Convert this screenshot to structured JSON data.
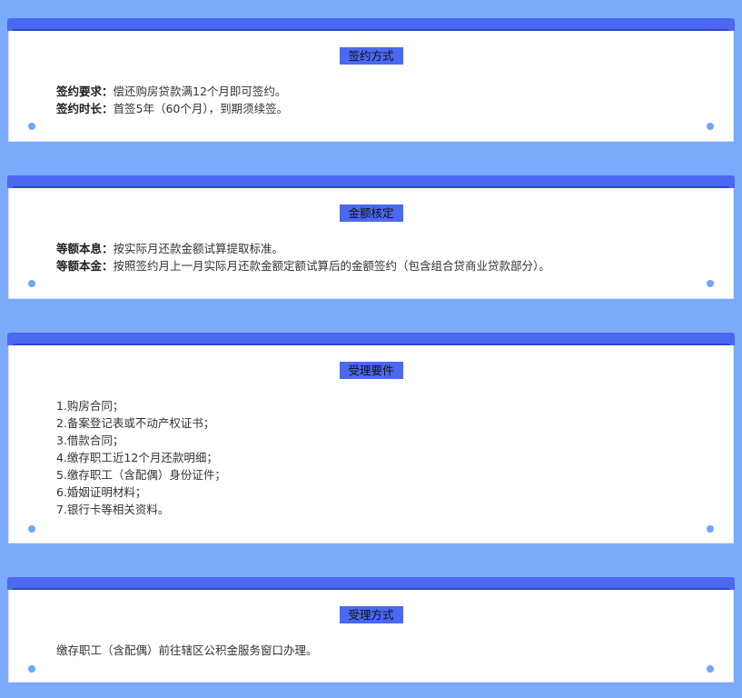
{
  "sections": [
    {
      "title": "签约方式",
      "lines": [
        {
          "label": "签约要求：",
          "text": "偿还购房贷款满12个月即可签约。"
        },
        {
          "label": "签约时长：",
          "text": "首签5年（60个月），到期须续签。"
        }
      ]
    },
    {
      "title": "金额核定",
      "lines": [
        {
          "label": "等额本息：",
          "text": "按实际月还款金额试算提取标准。"
        },
        {
          "label": "等额本金：",
          "text": "按照签约月上一月实际月还款金额定额试算后的金额签约（包含组合贷商业贷款部分）。"
        }
      ]
    },
    {
      "title": "受理要件",
      "items": [
        "1.购房合同；",
        "2.备案登记表或不动产权证书；",
        "3.借款合同；",
        "4.缴存职工近12个月还款明细；",
        "5.缴存职工（含配偶）身份证件；",
        "6.婚姻证明材料；",
        "7.银行卡等相关资料。"
      ]
    },
    {
      "title": "受理方式",
      "items": [
        "缴存职工（含配偶）前往辖区公积金服务窗口办理。"
      ]
    }
  ],
  "colors": {
    "background": "#7aabfa",
    "accent": "#4b68f0",
    "card": "#ffffff",
    "dot": "#6ea6fb"
  }
}
